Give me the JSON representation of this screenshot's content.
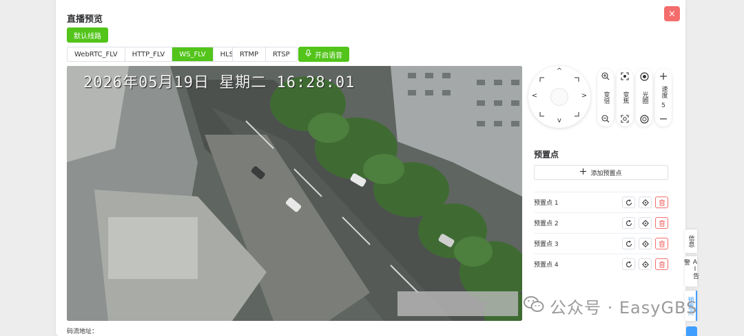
{
  "dialog": {
    "title": "直播预览",
    "close_label": "×",
    "route_button": "默认线路",
    "voice_button": "开启语音",
    "stream_label": "码流地址："
  },
  "protocol_tabs": [
    {
      "label": "WebRTC_FLV",
      "active": false
    },
    {
      "label": "HTTP_FLV",
      "active": false
    },
    {
      "label": "WS_FLV",
      "active": true
    },
    {
      "label": "HLS",
      "active": false
    }
  ],
  "protocol_tabs_2": [
    {
      "label": "RTMP",
      "active": false
    },
    {
      "label": "RTSP",
      "active": false
    }
  ],
  "video": {
    "osd_text": "2026年05月19日 星期二 16:28:01"
  },
  "ptz": {
    "arrows": [
      "^",
      "v",
      "<",
      ">"
    ],
    "zoom": {
      "label": "变倍",
      "icons": [
        "zoom-in-icon",
        "zoom-out-icon"
      ]
    },
    "focus": {
      "label": "变焦",
      "icons": [
        "focus-in-icon",
        "focus-out-icon"
      ]
    },
    "iris": {
      "label": "光圈",
      "icons": [
        "iris-open-icon",
        "iris-close-icon"
      ]
    },
    "speed": {
      "label": "速度",
      "value": "5"
    }
  },
  "presets": {
    "title": "预置点",
    "add_label": "添加预置点",
    "items": [
      {
        "name": "预置点 1"
      },
      {
        "name": "预置点 2"
      },
      {
        "name": "预置点 3"
      },
      {
        "name": "预置点 4"
      }
    ]
  },
  "side_tabs": [
    {
      "label": "信息",
      "active": false
    },
    {
      "label": "AI告警",
      "active": false
    },
    {
      "label": "预置点",
      "active": true
    }
  ],
  "watermark": "公众号 · EasyGBS",
  "colors": {
    "primary_green": "#52c41a",
    "danger_red": "#f56c6c",
    "accent_blue": "#409eff"
  }
}
